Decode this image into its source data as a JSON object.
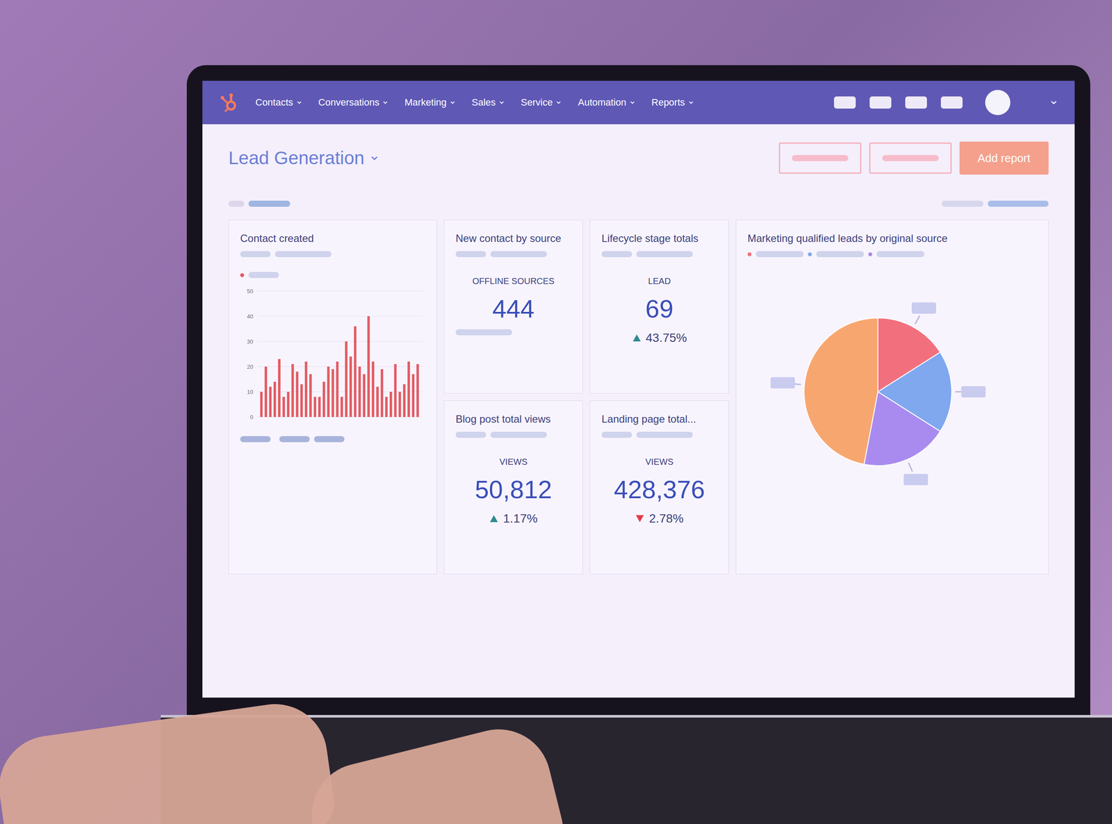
{
  "nav": {
    "items": [
      "Contacts",
      "Conversations",
      "Marketing",
      "Sales",
      "Service",
      "Automation",
      "Reports"
    ]
  },
  "header": {
    "title": "Lead Generation",
    "button": "Add report"
  },
  "contact_chart": {
    "title": "Contact created",
    "ticks": [
      "50",
      "40",
      "30",
      "20",
      "10",
      "0"
    ],
    "max": 50,
    "values": [
      10,
      20,
      12,
      14,
      23,
      8,
      10,
      21,
      18,
      13,
      22,
      17,
      8,
      8,
      14,
      20,
      19,
      22,
      8,
      30,
      24,
      36,
      20,
      17,
      40,
      22,
      12,
      19,
      8,
      10,
      21,
      10,
      13,
      22,
      17,
      21
    ]
  },
  "stats": [
    {
      "title": "New contact by source",
      "label": "OFFLINE SOURCES",
      "value": "444",
      "change": "",
      "trend": "none"
    },
    {
      "title": "Lifecycle stage totals",
      "label": "LEAD",
      "value": "69",
      "change": "43.75%",
      "trend": "up"
    },
    {
      "title": "Blog post total views",
      "label": "VIEWS",
      "value": "50,812",
      "change": "1.17%",
      "trend": "up"
    },
    {
      "title": "Landing page total...",
      "label": "VIEWS",
      "value": "428,376",
      "change": "2.78%",
      "trend": "down"
    }
  ],
  "pie": {
    "title": "Marketing qualified leads by original source",
    "slices": [
      {
        "value": 16,
        "color": "#f2707e"
      },
      {
        "value": 18,
        "color": "#7fa8ef"
      },
      {
        "value": 19,
        "color": "#a98bf0"
      },
      {
        "value": 47,
        "color": "#f8a66f"
      }
    ]
  }
}
